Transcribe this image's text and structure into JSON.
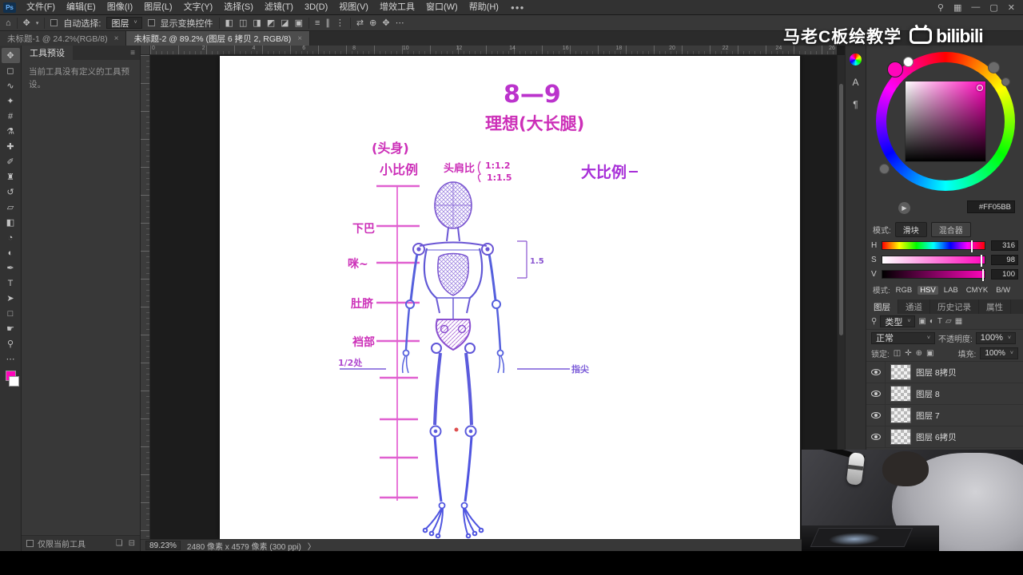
{
  "menu": {
    "items": [
      "文件(F)",
      "编辑(E)",
      "图像(I)",
      "图层(L)",
      "文字(Y)",
      "选择(S)",
      "滤镜(T)",
      "3D(D)",
      "视图(V)",
      "增效工具",
      "窗口(W)",
      "帮助(H)"
    ],
    "overflow": "●●●"
  },
  "window_icons": {
    "search": "⚲",
    "workspace": "▦",
    "minimize": "—",
    "maximize": "▢",
    "close": "✕"
  },
  "options": {
    "home": "⌂",
    "tool": "✥",
    "auto_select_label": "自动选择:",
    "auto_select_value": "图层",
    "show_transform": "显示变换控件",
    "align_icons": [
      "◧",
      "◫",
      "◨",
      "◩",
      "◪",
      "▣"
    ],
    "distribute_icons": [
      "≡",
      "∥",
      "⋮"
    ],
    "threed_icons": [
      "⇄",
      "⊕",
      "✥"
    ],
    "more": "⋯"
  },
  "tabs": {
    "tab1": "未标题-1 @ 24.2%(RGB/8)",
    "close1": "×",
    "tab2": "未标题-2 @ 89.2% (图层 6 拷贝 2, RGB/8)",
    "close2": "×"
  },
  "tools": [
    {
      "name": "move",
      "glyph": "✥"
    },
    {
      "name": "marquee",
      "glyph": "◻"
    },
    {
      "name": "lasso",
      "glyph": "∿"
    },
    {
      "name": "quick-select",
      "glyph": "✦"
    },
    {
      "name": "crop",
      "glyph": "#"
    },
    {
      "name": "eyedropper",
      "glyph": "⚗"
    },
    {
      "name": "healing",
      "glyph": "✚"
    },
    {
      "name": "brush",
      "glyph": "✐"
    },
    {
      "name": "clone-stamp",
      "glyph": "♜"
    },
    {
      "name": "history-brush",
      "glyph": "↺"
    },
    {
      "name": "eraser",
      "glyph": "▱"
    },
    {
      "name": "gradient",
      "glyph": "◧"
    },
    {
      "name": "blur",
      "glyph": "◔"
    },
    {
      "name": "dodge",
      "glyph": "◐"
    },
    {
      "name": "pen",
      "glyph": "✒"
    },
    {
      "name": "type",
      "glyph": "T"
    },
    {
      "name": "path-select",
      "glyph": "➤"
    },
    {
      "name": "shape",
      "glyph": "□"
    },
    {
      "name": "hand",
      "glyph": "☛"
    },
    {
      "name": "zoom",
      "glyph": "⚲"
    }
  ],
  "toolbar_more": "⋯",
  "foreground_color": "#FF05BB",
  "presets": {
    "title": "工具预设",
    "empty": "当前工具没有定义的工具预设。",
    "menu_icon": "≡",
    "footer_label": "仅限当前工具",
    "new_icon": "❏",
    "delete_icon": "⊟"
  },
  "ruler": {
    "numbers": [
      "0",
      "2",
      "4",
      "6",
      "8",
      "10",
      "12",
      "14",
      "16",
      "18",
      "20",
      "22",
      "24",
      "26"
    ]
  },
  "drawing": {
    "title": "8—9",
    "subtitle": "理想(大长腿)",
    "label_head": "(头身)",
    "label_small_ratio": "小比例",
    "label_shoulder": "头肩比",
    "ratio1": "1:1.2",
    "ratio2": "1:1.5",
    "label_big_ratio": "大比例",
    "tick_chin": "下巴",
    "tick_chest": "咪~",
    "tick_navel": "肚脐",
    "tick_crotch": "裆部",
    "tick_half": "1/2处",
    "tick_fingertip": "指尖",
    "measure": "1.5"
  },
  "status": {
    "zoom": "89.23%",
    "doc": "2480 像素 x 4579 像素 (300 ppi)",
    "arrow": "〉"
  },
  "side_strip": {
    "char_icon": "A",
    "para_icon": "¶"
  },
  "color_panel": {
    "tab_slider": "滑块",
    "tab_mixer": "混合器",
    "hex": "#FF05BB",
    "sliders": [
      {
        "label": "H",
        "value": "316"
      },
      {
        "label": "S",
        "value": "98"
      },
      {
        "label": "V",
        "value": "100"
      }
    ],
    "mode_label": "模式:",
    "modes": [
      "RGB",
      "HSV",
      "LAB",
      "CMYK",
      "B/W"
    ],
    "play_icon": "▶"
  },
  "layers_panel": {
    "tabs": [
      "图层",
      "通道",
      "历史记录",
      "属性"
    ],
    "search_icon": "⚲",
    "filter_label": "类型",
    "filter_icons": [
      "▣",
      "◐",
      "T",
      "▱",
      "▦"
    ],
    "blend_mode": "正常",
    "opacity_label": "不透明度:",
    "opacity": "100%",
    "lock_label": "锁定:",
    "lock_icons": [
      "◫",
      "✛",
      "⊕",
      "▣"
    ],
    "fill_label": "填充:",
    "fill": "100%",
    "layers": [
      "图层 8拷贝",
      "图层 8",
      "图层 7",
      "图层 6拷贝"
    ]
  },
  "watermark": {
    "text": "马老C板绘教学",
    "logo": "bilibili"
  }
}
